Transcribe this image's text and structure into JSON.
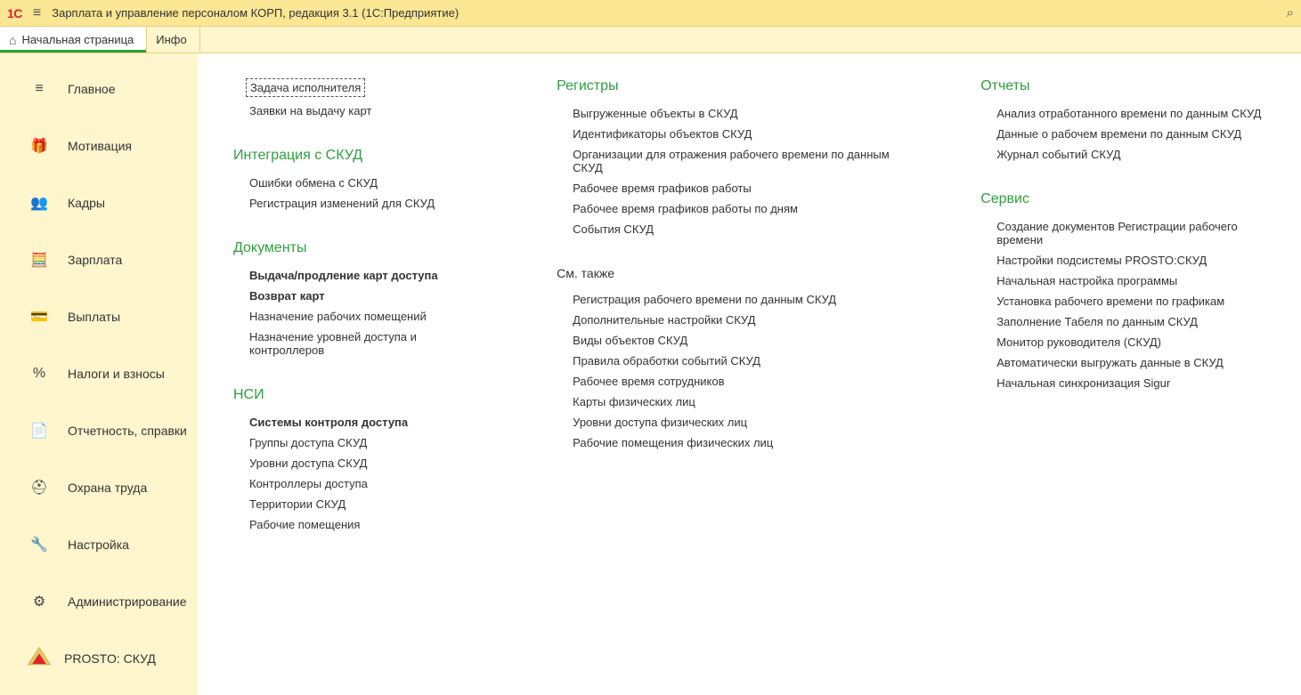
{
  "title": "Зарплата и управление персоналом КОРП, редакция 3.1  (1С:Предприятие)",
  "logo": "1С",
  "tabs": {
    "home": "Начальная страница",
    "partial": "Инфо"
  },
  "sidebar": [
    {
      "icon": "≡",
      "label": "Главное"
    },
    {
      "icon": "🎁",
      "label": "Мотивация"
    },
    {
      "icon": "👥",
      "label": "Кадры"
    },
    {
      "icon": "🧮",
      "label": "Зарплата"
    },
    {
      "icon": "💳",
      "label": "Выплаты"
    },
    {
      "icon": "%",
      "label": "Налоги и взносы"
    },
    {
      "icon": "📄",
      "label": "Отчетность, справки"
    },
    {
      "icon": "⛑",
      "label": "Охрана труда"
    },
    {
      "icon": "🔧",
      "label": "Настройка"
    },
    {
      "icon": "⚙",
      "label": "Администрирование"
    },
    {
      "icon": "",
      "label": "PROSTO: СКУД"
    }
  ],
  "col1": {
    "top_items": [
      "Задача исполнителя",
      "Заявки на выдачу карт"
    ],
    "h1": "Интеграция с СКУД",
    "items1": [
      "Ошибки обмена с СКУД",
      "Регистрация изменений для СКУД"
    ],
    "h2": "Документы",
    "items2": [
      {
        "t": "Выдача/продление карт доступа",
        "b": true
      },
      {
        "t": "Возврат карт",
        "b": true
      },
      {
        "t": "Назначение рабочих помещений"
      },
      {
        "t": "Назначение уровней доступа и контроллеров"
      }
    ],
    "h3": "НСИ",
    "items3": [
      {
        "t": "Системы контроля доступа",
        "b": true
      },
      {
        "t": "Группы доступа СКУД"
      },
      {
        "t": "Уровни доступа СКУД"
      },
      {
        "t": "Контроллеры доступа"
      },
      {
        "t": "Территории СКУД"
      },
      {
        "t": "Рабочие помещения"
      }
    ]
  },
  "col2": {
    "h1": "Регистры",
    "items1": [
      "Выгруженные объекты в СКУД",
      "Идентификаторы объектов СКУД",
      "Организации для отражения рабочего времени по данным СКУД",
      "Рабочее время графиков работы",
      "Рабочее время графиков работы по дням",
      "События СКУД"
    ],
    "h2": "См. также",
    "items2": [
      "Регистрация рабочего времени по данным СКУД",
      "Дополнительные настройки СКУД",
      "Виды объектов СКУД",
      "Правила обработки событий СКУД",
      "Рабочее время сотрудников",
      "Карты физических лиц",
      "Уровни доступа физических лиц",
      "Рабочие помещения физических лиц"
    ]
  },
  "col3": {
    "h1": "Отчеты",
    "items1": [
      "Анализ отработанного времени по данным СКУД",
      "Данные о рабочем времени по данным СКУД",
      "Журнал событий СКУД"
    ],
    "h2": "Сервис",
    "items2": [
      "Создание документов Регистрации рабочего времени",
      "Настройки подсистемы PROSTO:СКУД",
      "Начальная настройка программы",
      "Установка рабочего времени по графикам",
      "Заполнение Табеля по данным СКУД",
      "Монитор руководителя (СКУД)",
      "Автоматически выгружать данные в СКУД",
      "Начальная синхронизация Sigur"
    ]
  }
}
